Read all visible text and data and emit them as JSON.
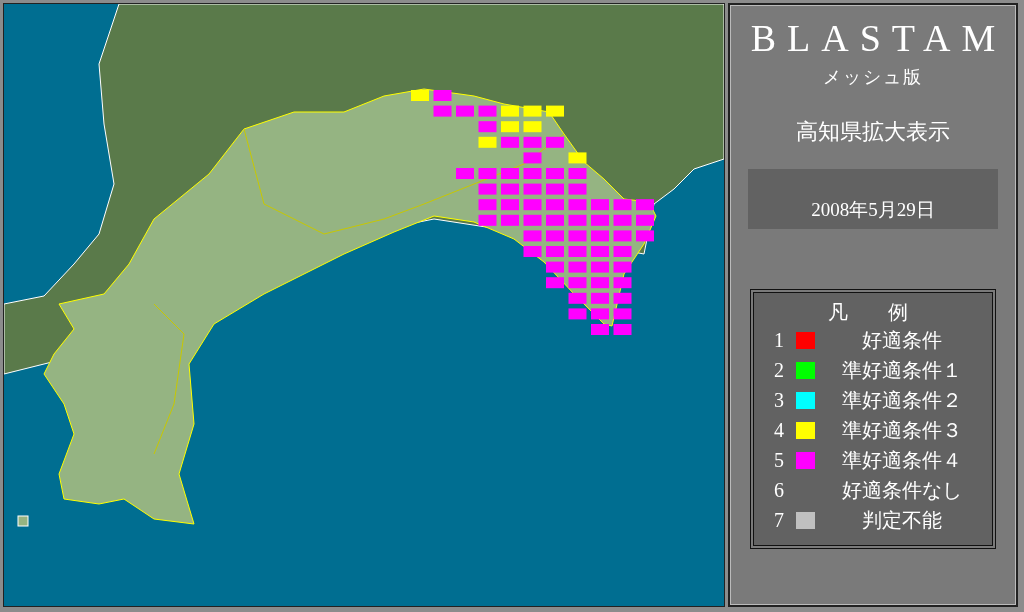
{
  "panel": {
    "title": "BLASTAM",
    "subtitle": "メッシュ版",
    "view": "高知県拡大表示",
    "date": "2008年5月29日"
  },
  "legend": {
    "title": "凡　　例",
    "items": [
      {
        "number": "1",
        "label": "好適条件",
        "color": "#ff0000"
      },
      {
        "number": "2",
        "label": "準好適条件１",
        "color": "#00ff00"
      },
      {
        "number": "3",
        "label": "準好適条件２",
        "color": "#00ffff"
      },
      {
        "number": "4",
        "label": "準好適条件３",
        "color": "#ffff00"
      },
      {
        "number": "5",
        "label": "準好適条件４",
        "color": "#ff00ff"
      },
      {
        "number": "6",
        "label": "好適条件なし"
      },
      {
        "number": "7",
        "label": "判定不能",
        "color": "#c0c0c0"
      }
    ]
  }
}
